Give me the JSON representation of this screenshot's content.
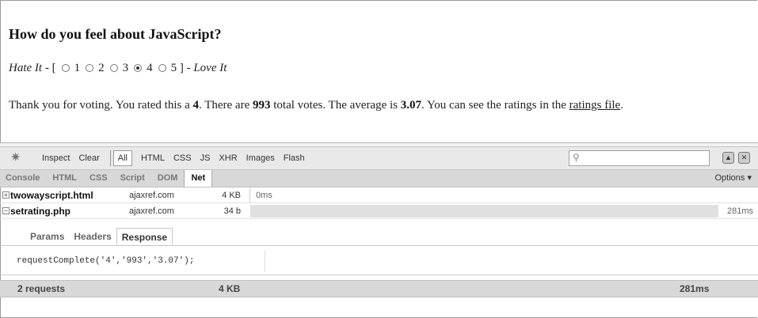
{
  "page": {
    "heading": "How do you feel about JavaScript?",
    "rating": {
      "left_label": "Hate It",
      "dash_open": " - [",
      "options": [
        "1",
        "2",
        "3",
        "4",
        "5"
      ],
      "selected": "4",
      "close_dash": " ] - ",
      "right_label": "Love It"
    },
    "thanks": {
      "t1": "Thank you for voting. You rated this a ",
      "rated": "4",
      "t2": ". There are ",
      "total": "993",
      "t3": " total votes. The average is ",
      "average": "3.07",
      "t4": ". You can see the ratings in the ",
      "link": "ratings file",
      "t5": "."
    }
  },
  "firebug": {
    "toolbar": {
      "inspect": "Inspect",
      "clear": "Clear",
      "filters": [
        "All",
        "HTML",
        "CSS",
        "JS",
        "XHR",
        "Images",
        "Flash"
      ],
      "search_placeholder": ""
    },
    "tabs": [
      "Console",
      "HTML",
      "CSS",
      "Script",
      "DOM",
      "Net"
    ],
    "active_tab": "Net",
    "options": "Options ▾",
    "requests": [
      {
        "toggle": "+",
        "file": "twowayscript.html",
        "domain": "ajaxref.com",
        "size": "4 KB",
        "time": "0ms"
      },
      {
        "toggle": "−",
        "file": "setrating.php",
        "domain": "ajaxref.com",
        "size": "34 b",
        "time": "281ms"
      }
    ],
    "subtabs": [
      "Params",
      "Headers",
      "Response"
    ],
    "active_subtab": "Response",
    "response_body": "requestComplete('4','993','3.07');",
    "summary": {
      "requests": "2 requests",
      "size": "4 KB",
      "time": "281ms"
    }
  },
  "icons": {
    "firebug": "firebug-icon",
    "search": "search-icon",
    "minimize": "minimize-icon",
    "close": "close-icon"
  }
}
